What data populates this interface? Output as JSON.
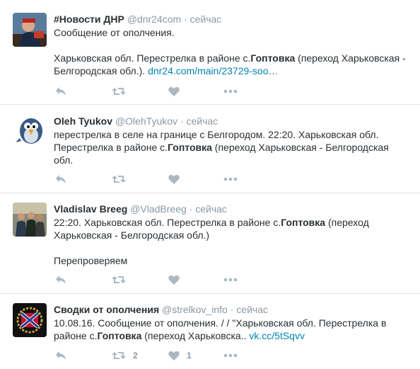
{
  "tweets": [
    {
      "fullname": "#Новости ДНР",
      "username": "@dnr24com",
      "dot": "·",
      "time": "сейчас",
      "avatar_icon": "dnr-news-avatar",
      "line1": "Сообщение от ополчения.",
      "line2_a": "Харьковская обл. Перестрелка в районе с.",
      "line2_kw": "Гоптовка",
      "line2_b": " (переход Харьковская -",
      "line3_a": "Белгородская обл.). ",
      "line3_link": "dnr24.com/main/23729-soo…",
      "retweets": "",
      "likes": ""
    },
    {
      "fullname": "Oleh Tyukov",
      "username": "@OlehTyukov",
      "dot": "·",
      "time": "сейчас",
      "avatar_icon": "bird-avatar",
      "line1": "перестрелка в селе на границе с Белгородом. 22:20. Харьковская обл.",
      "line2_a": "Перестрелка в районе с.",
      "line2_kw": "Гоптовка",
      "line2_b": " (переход Харьковская - Белгородская",
      "line3": "обл.",
      "retweets": "",
      "likes": ""
    },
    {
      "fullname": "Vladislav Breeg",
      "username": "@VladBreeg",
      "dot": "·",
      "time": "сейчас",
      "avatar_icon": "group-photo-avatar",
      "line1_a": "22:20. Харьковская обл. Перестрелка в районе с.",
      "line1_kw": "Гоптовка",
      "line1_b": " (переход",
      "line2": "Харьковская - Белгородская обл.)",
      "line3": "Перепроверяем",
      "retweets": "",
      "likes": ""
    },
    {
      "fullname": "Сводки от ополчения",
      "username": "@strelkov_info",
      "dot": "·",
      "time": "сейчас",
      "avatar_icon": "novorossiya-flag-avatar",
      "line1": "10.08.16. Сообщение от ополчения. /  / \"Харьковская обл. Перестрелка в",
      "line2_a": "районе с.",
      "line2_kw": "Гоптовка",
      "line2_b": " (переход Харьковска.. ",
      "line2_link": "vk.cc/5tSqvv",
      "retweets": "2",
      "likes": "1"
    }
  ],
  "colors": {
    "link": "#0084b4",
    "action": "#aab8c2",
    "meta": "#8899a6"
  }
}
